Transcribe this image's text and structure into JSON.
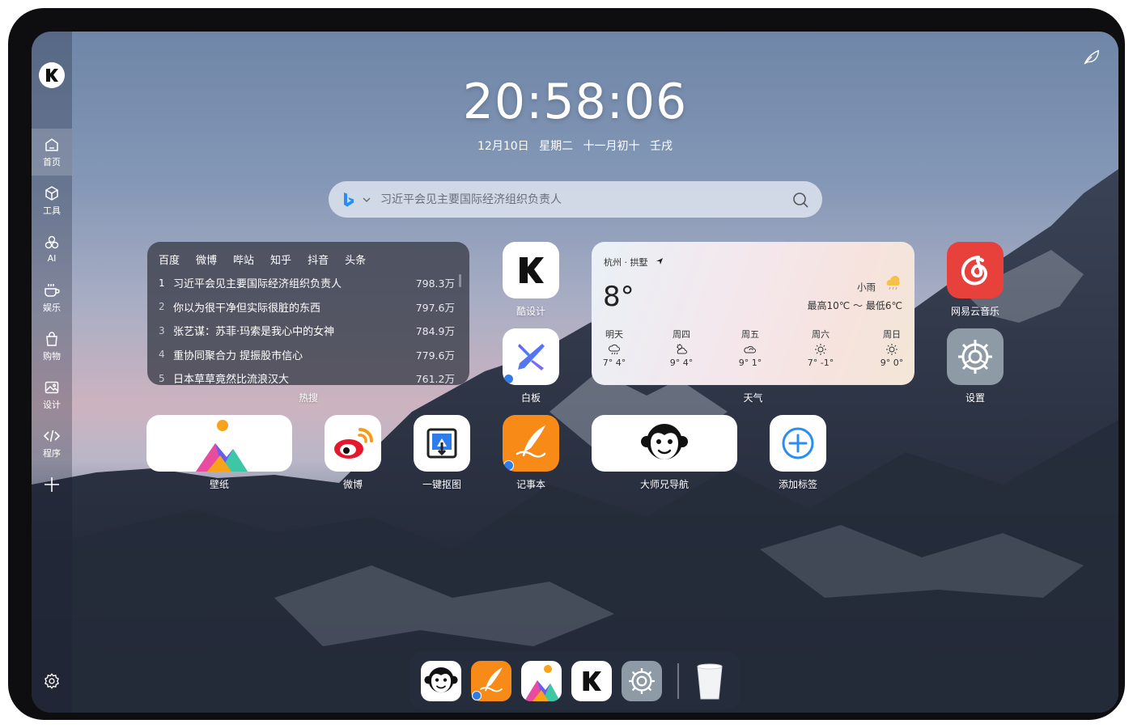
{
  "clock": {
    "time": "20:58:06"
  },
  "date": {
    "day": "12月10日",
    "weekday": "星期二",
    "lunar": "十一月初十",
    "ganzhi": "壬戌"
  },
  "search": {
    "placeholder": "习近平会见主要国际经济组织负责人",
    "engine_icon": "bing-icon"
  },
  "sidebar": {
    "logo_icon": "k-logo-icon",
    "items": [
      {
        "label": "首页",
        "icon": "home-icon",
        "active": true
      },
      {
        "label": "工具",
        "icon": "cube-icon"
      },
      {
        "label": "AI",
        "icon": "ai-icon"
      },
      {
        "label": "娱乐",
        "icon": "coffee-icon"
      },
      {
        "label": "购物",
        "icon": "bag-icon"
      },
      {
        "label": "设计",
        "icon": "image-icon"
      },
      {
        "label": "程序",
        "icon": "code-icon"
      }
    ]
  },
  "hot": {
    "tabs": [
      "百度",
      "微博",
      "哔站",
      "知乎",
      "抖音",
      "头条"
    ],
    "rows": [
      {
        "rank": "1",
        "title": "习近平会见主要国际经济组织负责人",
        "value": "798.3万"
      },
      {
        "rank": "2",
        "title": "你以为很干净但实际很脏的东西",
        "value": "797.6万"
      },
      {
        "rank": "3",
        "title": "张艺谋：苏菲·玛索是我心中的女神",
        "value": "784.9万"
      },
      {
        "rank": "4",
        "title": "重协同聚合力 提振股市信心",
        "value": "779.6万"
      },
      {
        "rank": "5",
        "title": "日本草草竟然比流浪汉大",
        "value": "761.2万"
      }
    ],
    "caption": "热搜"
  },
  "apps": {
    "kushe": "酷设计",
    "whiteboard": "白板",
    "weather": "天气",
    "netease": "网易云音乐",
    "settings": "设置",
    "wallpaper": "壁纸",
    "weibo": "微博",
    "cutout": "一键抠图",
    "notepad": "记事本",
    "dashixiong": "大师兄导航",
    "addtag": "添加标签"
  },
  "weather": {
    "city": "杭州 · 拱墅",
    "temp": "8°",
    "condition": "小雨",
    "range": "最高10℃ ～ 最低6℃",
    "forecast": [
      {
        "day": "明天",
        "icon": "rain-icon",
        "temp": "7° 4°"
      },
      {
        "day": "周四",
        "icon": "partly-cloudy-icon",
        "temp": "9° 4°"
      },
      {
        "day": "周五",
        "icon": "cloudy-icon",
        "temp": "9° 1°"
      },
      {
        "day": "周六",
        "icon": "sun-icon",
        "temp": "7° -1°"
      },
      {
        "day": "周日",
        "icon": "sun-icon",
        "temp": "9° 0°"
      }
    ]
  },
  "dock": {
    "items": [
      "monkey-icon",
      "notepad-icon",
      "wallpaper-icon",
      "k-logo-icon",
      "settings-icon",
      "trash-icon"
    ]
  },
  "colors": {
    "netease_red": "#e8413c",
    "notepad_orange": "#f88a18",
    "settings_gray": "#8e9ba6",
    "bing_blue": "#2a8df2"
  }
}
